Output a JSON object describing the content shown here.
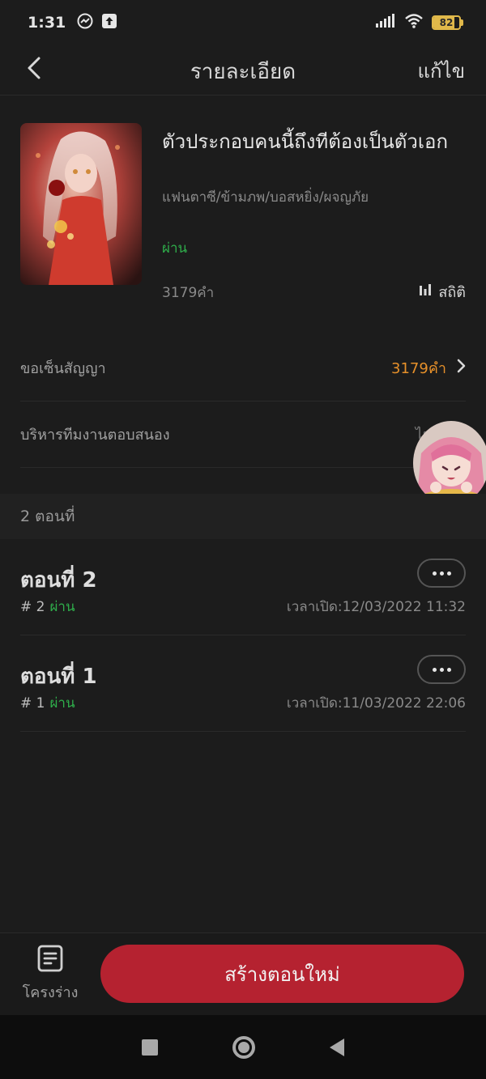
{
  "status_bar": {
    "time": "1:31",
    "battery": "82",
    "battery_level": 0.82,
    "icons": [
      "messenger-icon",
      "upload-icon",
      "signal-icon",
      "wifi-icon",
      "battery-icon"
    ]
  },
  "header": {
    "title": "รายละเอียด",
    "edit_label": "แก้ไข",
    "back_icon": "chevron-left-icon"
  },
  "book": {
    "title": "ตัวประกอบคนนี้ถึงทีต้องเป็นตัวเอก",
    "genres": "แฟนตาซี/ข้ามภพ/บอสหยิ่ง/ผจญภัย",
    "status": "ผ่าน",
    "word_count": "3179คำ",
    "stats_label": "สถิติ"
  },
  "rows": {
    "contract_label": "ขอเซ็นสัญญา",
    "contract_value": "3179คำ",
    "response_label": "บริหารทีมงานตอบสนอง",
    "response_value": "ไม่ได้ตั้ง"
  },
  "chapters_section": {
    "count_label": "2 ตอนที่"
  },
  "chapters": [
    {
      "title": "ตอนที่ 2",
      "number": "# 2",
      "status": "ผ่าน",
      "date": "เวลาเปิด:12/03/2022 11:32"
    },
    {
      "title": "ตอนที่ 1",
      "number": "# 1",
      "status": "ผ่าน",
      "date": "เวลาเปิด:11/03/2022 22:06"
    }
  ],
  "bottom": {
    "outline_label": "โครงร่าง",
    "create_label": "สร้างตอนใหม่"
  },
  "colors": {
    "background": "#1c1c1c",
    "accent_red": "#b52230",
    "status_green": "#2fae4b",
    "contract_orange": "#e6902a"
  }
}
